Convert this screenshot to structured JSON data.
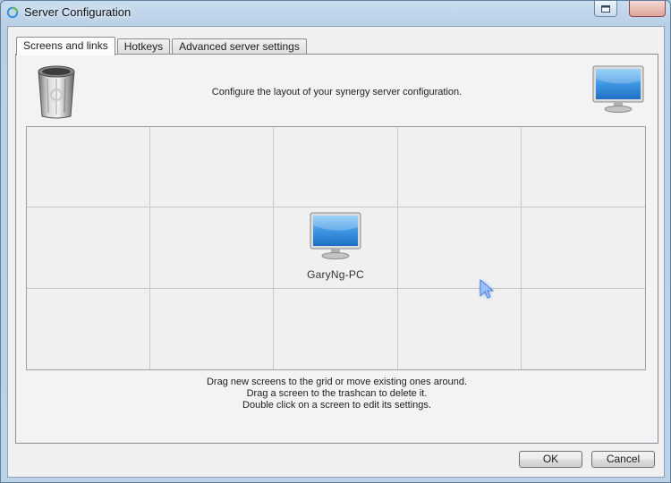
{
  "window": {
    "title": "Server Configuration"
  },
  "tabs": [
    {
      "label": "Screens and links",
      "active": true
    },
    {
      "label": "Hotkeys",
      "active": false
    },
    {
      "label": "Advanced server settings",
      "active": false
    }
  ],
  "screens_tab": {
    "instructions": "Configure the layout of your synergy server configuration.",
    "grid": {
      "columns": 5,
      "rows": 3,
      "screens": [
        {
          "name": "GaryNg-PC",
          "row": 2,
          "column": 3
        }
      ]
    },
    "hints": [
      "Drag new screens to the grid or move existing ones around.",
      "Drag a screen to the trashcan to delete it.",
      "Double click on a screen to edit its settings."
    ]
  },
  "buttons": {
    "ok": "OK",
    "cancel": "Cancel"
  },
  "icons": {
    "app": "synergy-icon",
    "trash": "trashcan-icon",
    "new_screen": "monitor-icon",
    "restore": "restore-icon",
    "close": "close-icon"
  },
  "colors": {
    "monitor_screen": "#3f96e3",
    "window_frame": "#bcd2e7",
    "close_button": "#dba49a"
  }
}
